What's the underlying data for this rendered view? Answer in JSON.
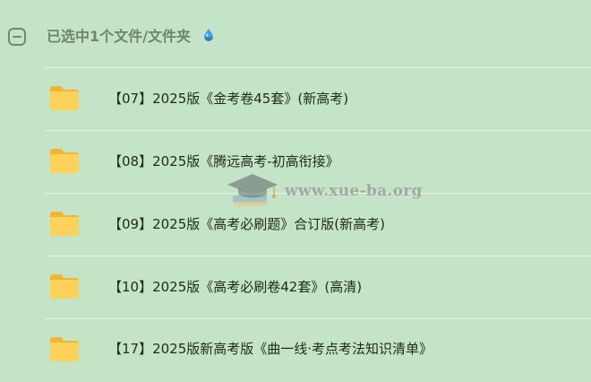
{
  "header": {
    "selected_text": "已选中1个文件/文件夹",
    "icon": "sync-drop-icon"
  },
  "files": [
    {
      "name": "【07】2025版《金考卷45套》(新高考)",
      "icon": "folder-icon"
    },
    {
      "name": "【08】2025版《腾远高考-初高衔接》",
      "icon": "folder-icon"
    },
    {
      "name": "【09】2025版《高考必刷题》合订版(新高考)",
      "icon": "folder-icon"
    },
    {
      "name": "【10】2025版《高考必刷卷42套》(高清)",
      "icon": "folder-icon"
    },
    {
      "name": "【17】2025版新高考版《曲一线·考点考法知识清单》",
      "icon": "folder-icon"
    }
  ],
  "watermark": {
    "text": "www.xue-ba.org",
    "icon": "graduation-cap-icon"
  },
  "colors": {
    "background": "#c4e4c7",
    "divider": "#e8f4e9",
    "folder": "#f7c948",
    "header_text": "#6e8571",
    "file_text": "#1f2a1f"
  }
}
